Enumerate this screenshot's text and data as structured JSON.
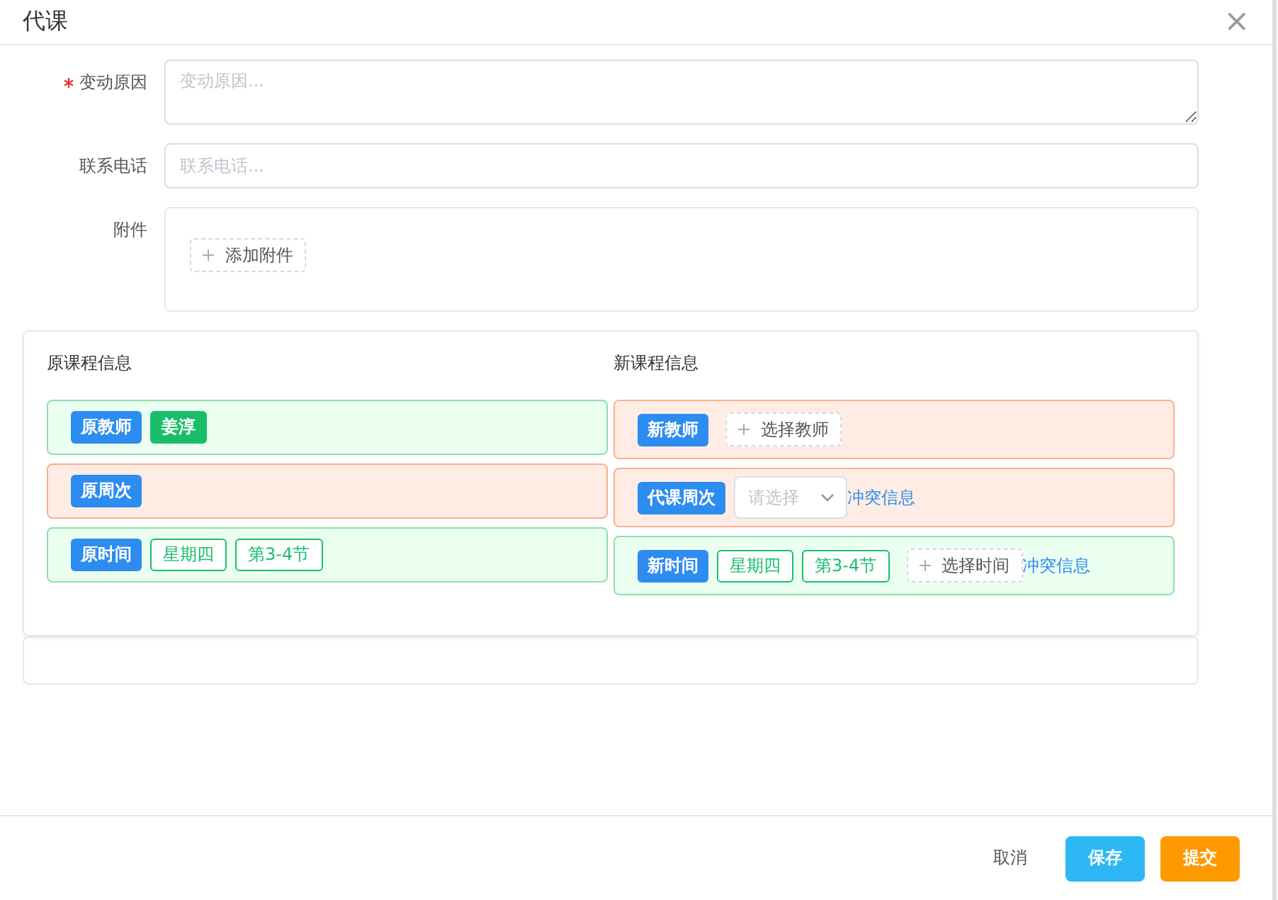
{
  "dialog": {
    "title": "代课",
    "close": "×"
  },
  "form": [
    {
      "label": "变动原因",
      "required": true,
      "kind": "textarea",
      "placeholder": "变动原因..."
    },
    {
      "label": "联系电话",
      "required": false,
      "kind": "input",
      "placeholder": "联系电话..."
    },
    {
      "label": "附件",
      "required": false,
      "kind": "upload",
      "button": "添加附件"
    }
  ],
  "original": {
    "title": "原课程信息",
    "rows": [
      {
        "conflict": false,
        "label": "原教师",
        "items": [
          {
            "kind": "solid",
            "text": "姜淳"
          }
        ]
      },
      {
        "conflict": true,
        "label": "原周次",
        "items": []
      },
      {
        "conflict": false,
        "label": "原时间",
        "items": [
          {
            "kind": "outline",
            "text": "星期四"
          },
          {
            "kind": "outline",
            "text": "第3-4节"
          }
        ]
      }
    ]
  },
  "replacement": {
    "title": "新课程信息",
    "rows": [
      {
        "conflict": true,
        "label": "新教师",
        "items": [
          {
            "kind": "add",
            "text": "选择教师"
          }
        ]
      },
      {
        "conflict": true,
        "label": "代课周次",
        "items": [
          {
            "kind": "select",
            "placeholder": "请选择"
          },
          {
            "kind": "link",
            "text": "冲突信息"
          }
        ]
      },
      {
        "conflict": false,
        "label": "新时间",
        "items": [
          {
            "kind": "outline",
            "text": "星期四"
          },
          {
            "kind": "outline",
            "text": "第3-4节"
          },
          {
            "kind": "add",
            "text": "选择时间"
          },
          {
            "kind": "link",
            "text": "冲突信息"
          }
        ]
      }
    ]
  },
  "footer": {
    "buttons": [
      {
        "kind": "text",
        "label": "取消"
      },
      {
        "kind": "save",
        "label": "保存"
      },
      {
        "kind": "submit",
        "label": "提交"
      }
    ]
  }
}
